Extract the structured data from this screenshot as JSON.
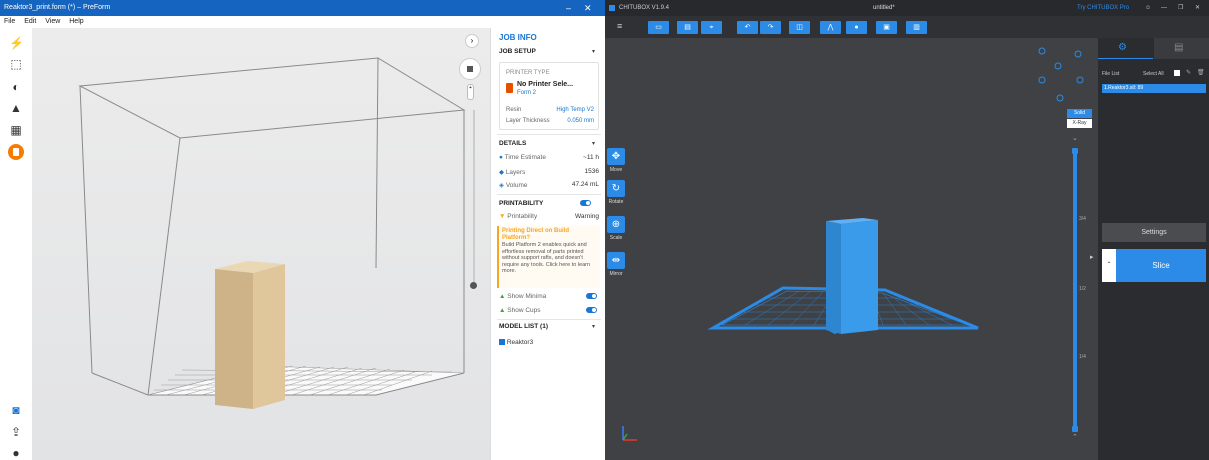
{
  "left_app": {
    "window_title": "Reaktor3_print.form (*) – PreForm",
    "menu": [
      "File",
      "Edit",
      "View",
      "Help"
    ],
    "panel": {
      "title": "JOB INFO",
      "job_setup": {
        "heading": "JOB SETUP",
        "printer_type_label": "PRINTER TYPE",
        "printer_name": "No Printer Sele...",
        "printer_model": "Form 2",
        "resin_label": "Resin",
        "resin_value": "High Temp V2",
        "layer_label": "Layer Thickness",
        "layer_value": "0.050 mm"
      },
      "details": {
        "heading": "DETAILS",
        "time_label": "Time Estimate",
        "time_value": "~11 h",
        "layers_label": "Layers",
        "layers_value": "1536",
        "volume_label": "Volume",
        "volume_value": "47.24 mL"
      },
      "printability": {
        "heading": "PRINTABILITY",
        "label": "Printability",
        "value": "Warning",
        "warning_title": "Printing Direct on Build Platform?",
        "warning_body": "Build Platform 2 enables quick and effortless removal of parts printed without support rafts, and doesn't require any tools. Click here to learn more.",
        "show_minima": "Show Minima",
        "show_cups": "Show Cups"
      },
      "model_list": {
        "heading": "MODEL LIST (1)",
        "items": [
          "Reaktor3"
        ]
      }
    },
    "colors": {
      "accent": "#1976d2",
      "model": "#dcc49a",
      "title_bar": "#1565c0",
      "warning": "#f5a623"
    }
  },
  "right_app": {
    "window_title": "CHITUBOX V1.9.4",
    "doc_title": "untitled*",
    "try_pro": "Try CHITUBOX Pro",
    "tools": [
      "Move",
      "Rotate",
      "Scale",
      "Mirror"
    ],
    "view_modes": [
      "Solid",
      "X-Ray"
    ],
    "file_list_label": "File List",
    "select_all": "Select All",
    "file_item": "1.Reaktor3.stl: 89",
    "settings_label": "Settings",
    "slice_label": "Slice",
    "ruler_marks": [
      "3/4",
      "1/2",
      "1/4"
    ],
    "colors": {
      "accent": "#2b8be6",
      "bg": "#3f4144",
      "panel": "#2b2c2f"
    }
  }
}
